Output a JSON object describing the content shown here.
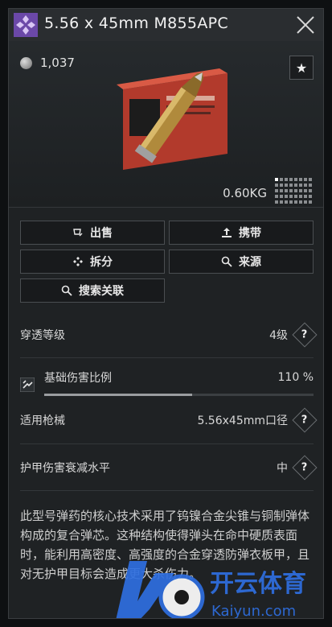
{
  "item": {
    "title": "5.56 x 45mm M855APC",
    "price": "1,037",
    "weight": "0.60KG"
  },
  "actions": {
    "sell": "出售",
    "carry": "携带",
    "disassemble": "拆分",
    "source": "来源",
    "search_related": "搜索关联"
  },
  "stats": {
    "penetration_label": "穿透等级",
    "penetration_value": "4级",
    "damage_label": "基础伤害比例",
    "damage_value": "110 %",
    "damage_fraction": 0.55,
    "weapon_label": "适用枪械",
    "weapon_value": "5.56x45mm口径",
    "armor_label": "护甲伤害衰减水平",
    "armor_value": "中",
    "help": "?"
  },
  "description": "此型号弹药的核心技术采用了钨镍合金尖锥与铜制弹体构成的复合弹芯。这种结构使得弹头在命中硬质表面时，能利用高密度、高强度的合金穿透防弹衣板甲，且对无护甲目标会造成更大杀伤力。",
  "watermark": {
    "logo_text": "开云体育",
    "logo_sub": "Kaiyun.com"
  },
  "colors": {
    "accent": "#8a5cc6",
    "panel": "#1f2224"
  },
  "icons": [
    "rarity-diamond-icon",
    "close-icon",
    "coin-icon",
    "star-icon",
    "weight-grid-icon",
    "sell-icon",
    "carry-icon",
    "disassemble-icon",
    "search-icon",
    "help-icon",
    "damage-icon"
  ]
}
